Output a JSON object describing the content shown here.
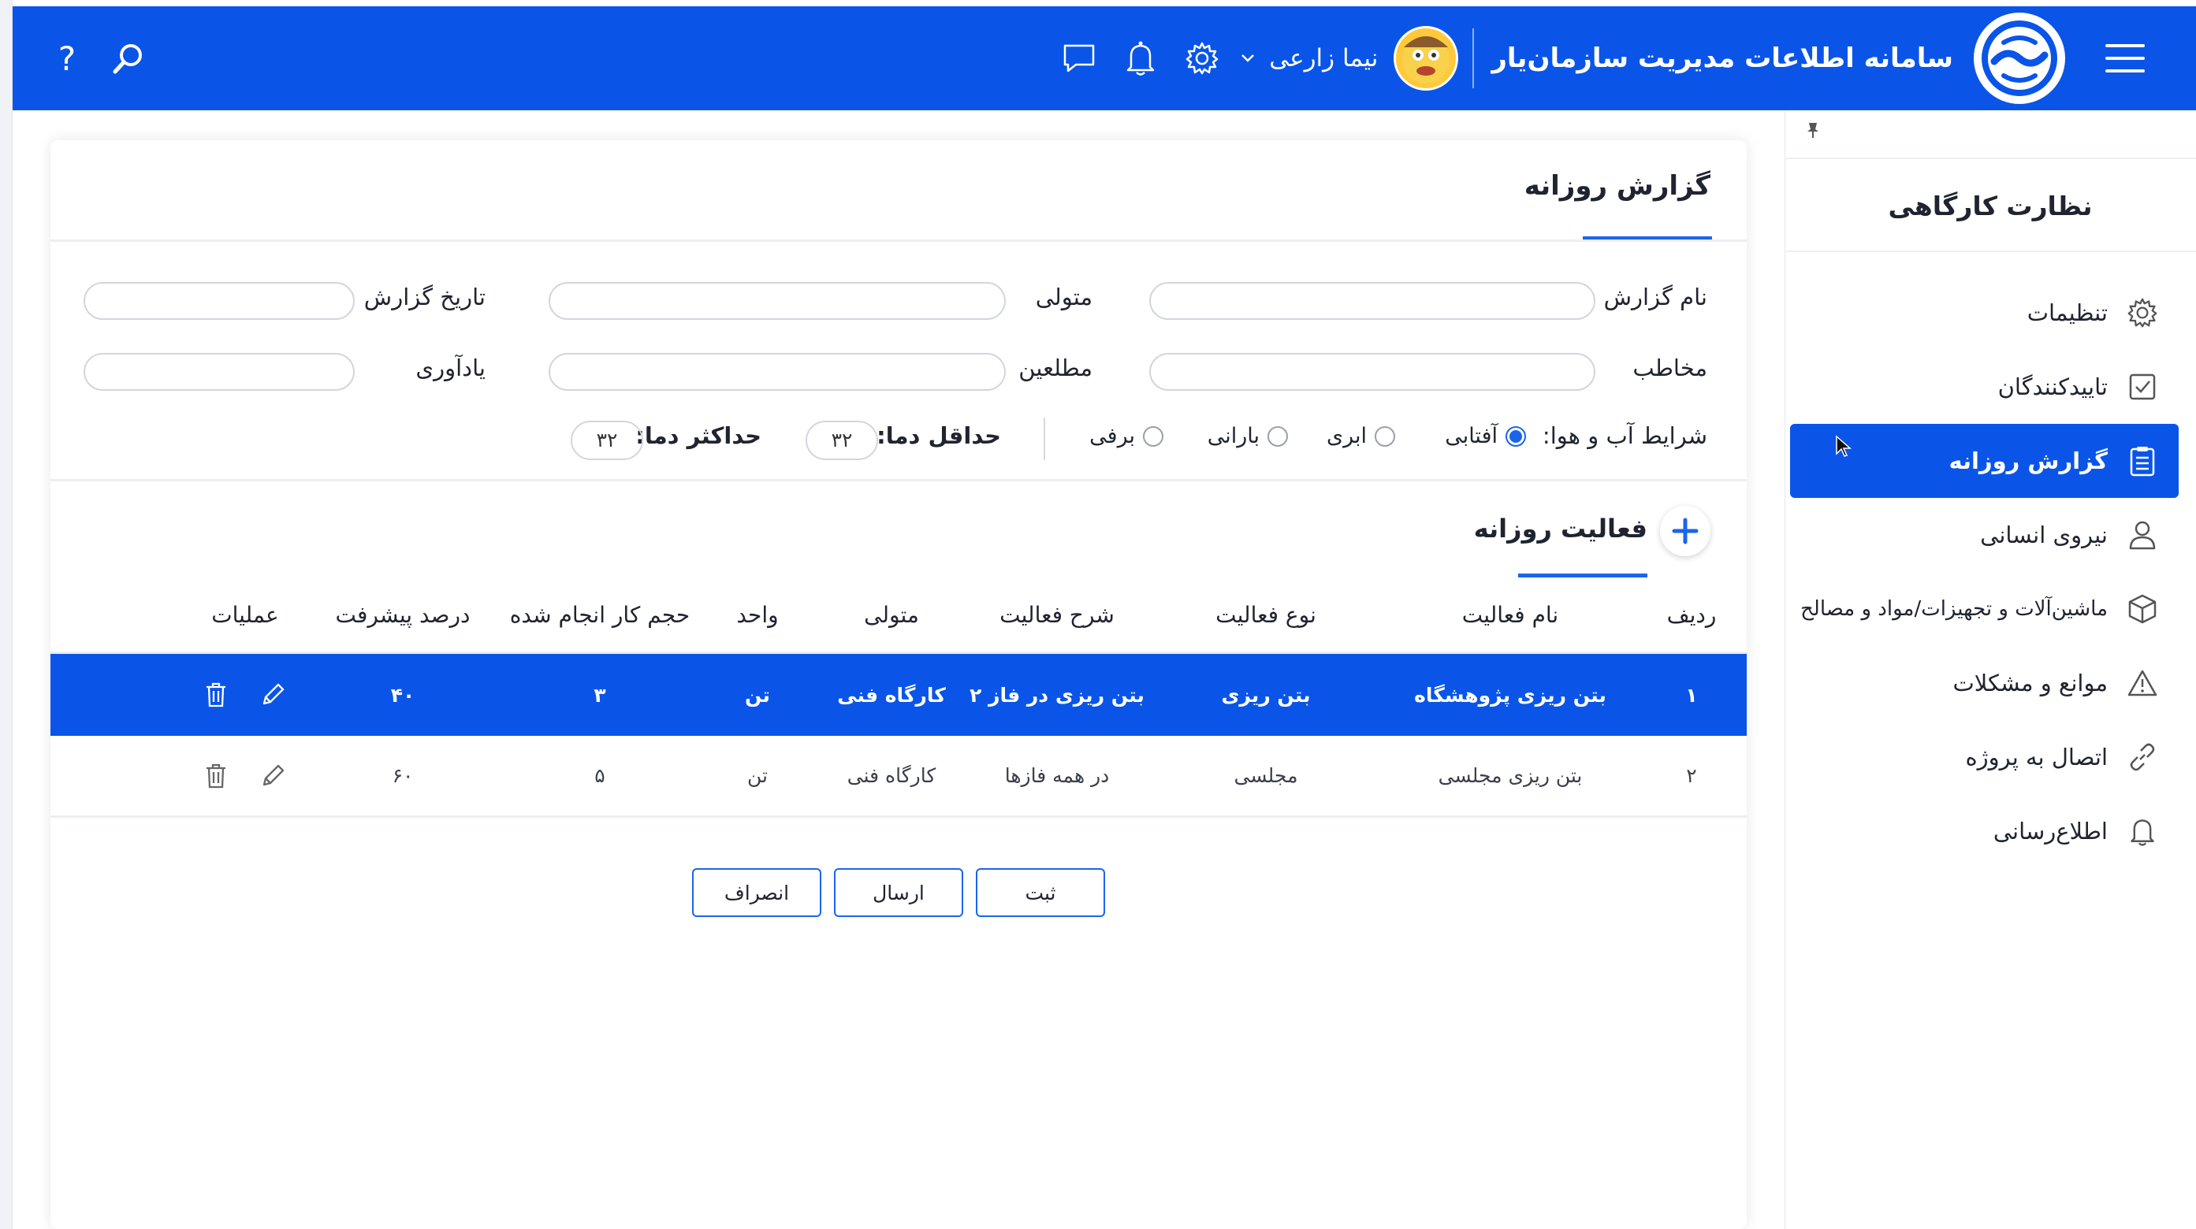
{
  "header": {
    "app_title": "سامانه اطلاعات مدیریت سازمان‌یار",
    "user_name": "نیما زارعی",
    "icons": [
      "menu-icon",
      "logo-handshake-icon",
      "chevron-down-icon",
      "settings-gear-icon",
      "bell-icon",
      "chat-icon",
      "search-icon",
      "help-icon"
    ],
    "help_label": "?"
  },
  "sidebar": {
    "title": "نظارت کارگاهی",
    "items": [
      {
        "label": "تنظیمات",
        "icon": "gear-icon",
        "active": false
      },
      {
        "label": "تاییدکنندگان",
        "icon": "checkbox-icon",
        "active": false
      },
      {
        "label": "گزارش روزانه",
        "icon": "clipboard-icon",
        "active": true
      },
      {
        "label": "نیروی انسانی",
        "icon": "user-icon",
        "active": false
      },
      {
        "label": "ماشین‌آلات و تجهیزات/مواد و مصالح",
        "icon": "cube-icon",
        "active": false
      },
      {
        "label": "موانع و مشکلات",
        "icon": "warning-icon",
        "active": false
      },
      {
        "label": "اتصال به پروژه",
        "icon": "link-icon",
        "active": false
      },
      {
        "label": "اطلاع‌رسانی",
        "icon": "bell-icon",
        "active": false
      }
    ]
  },
  "report": {
    "title": "گزارش روزانه",
    "fields": {
      "report_name": "نام گزارش",
      "custodian": "متولی",
      "report_date": "تاریخ گزارش",
      "addressee": "مخاطب",
      "informed": "مطلعین",
      "reminder": "یادآوری"
    },
    "weather": {
      "label": "شرایط آب و هوا:",
      "options": [
        "آفتابی",
        "ابری",
        "بارانی",
        "برفی"
      ],
      "selected": "آفتابی",
      "min_label": "حداقل دما:",
      "min_value": "۳۲",
      "max_label": "حداکثر دما:",
      "max_value": "۳۲"
    }
  },
  "activities": {
    "title": "فعالیت روزانه",
    "columns": [
      "ردیف",
      "نام فعالیت",
      "نوع فعالیت",
      "شرح فعالیت",
      "متولی",
      "واحد",
      "حجم کار انجام شده",
      "درصد پیشرفت",
      "عملیات"
    ],
    "rows": [
      {
        "row": "۱",
        "name": "بتن ریزی پژوهشگاه",
        "type": "بتن ریزی",
        "desc": "بتن ریزی در فاز ۲",
        "custodian": "کارگاه فنی",
        "unit": "تن",
        "volume": "۳",
        "progress": "۴۰",
        "selected": true
      },
      {
        "row": "۲",
        "name": "بتن ریزی مجلسی",
        "type": "مجلسی",
        "desc": "در همه فازها",
        "custodian": "کارگاه فنی",
        "unit": "تن",
        "volume": "۵",
        "progress": "۶۰",
        "selected": false
      }
    ]
  },
  "buttons": {
    "submit": "ثبت",
    "send": "ارسال",
    "cancel": "انصراف"
  }
}
